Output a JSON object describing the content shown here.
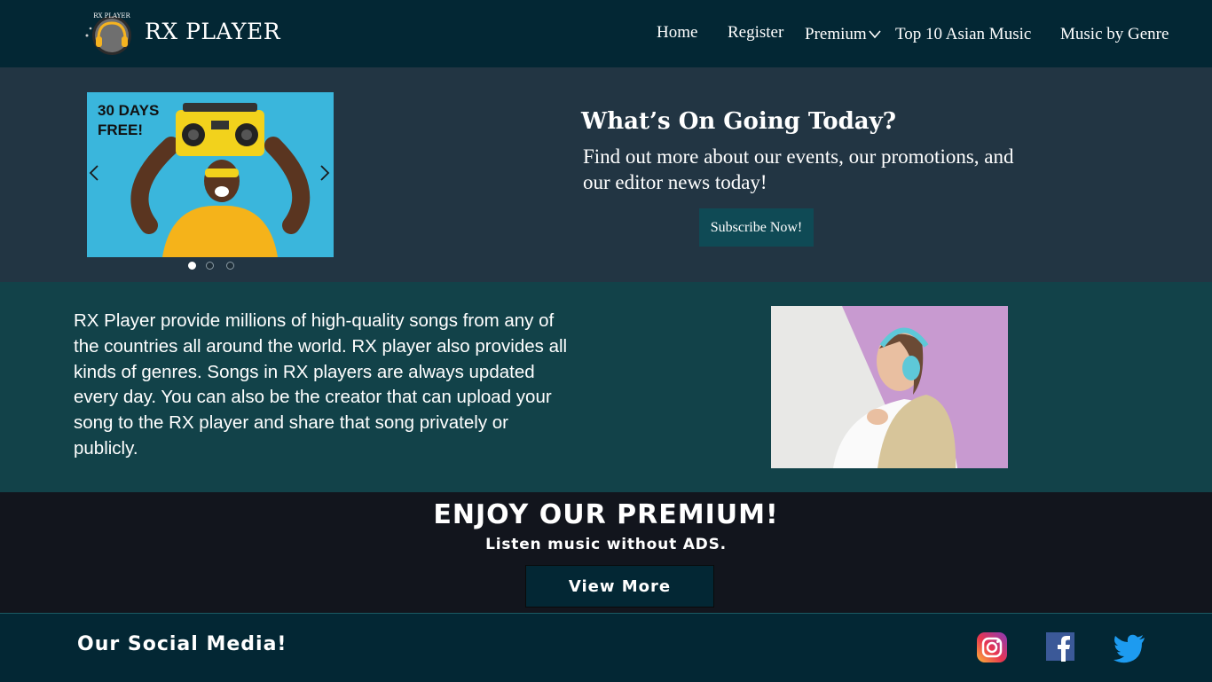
{
  "header": {
    "brand": "RX PLAYER",
    "logo_text": "RX PLAYER",
    "nav": {
      "home": "Home",
      "register": "Register",
      "premium": "Premium",
      "top10": "Top 10 Asian Music",
      "genre": "Music by Genre"
    }
  },
  "hero": {
    "slide": {
      "tag": "30 DAYS\nFREE!",
      "current": 1,
      "total": 3
    },
    "title": "What’s On Going Today?",
    "text": "Find out more about our events, our promotions, and our editor news today!",
    "subscribe_label": "Subscribe Now!"
  },
  "about": {
    "text": "RX Player provide millions of high-quality songs from any of the countries all around the world. RX player also provides all kinds of genres. Songs in RX players are always updated every day. You can also be the creator that can upload your song to the RX player and share that song privately or publicly."
  },
  "premium": {
    "title": "ENJOY OUR PREMIUM!",
    "subtitle": "Listen music without ADS.",
    "button_label": "View More"
  },
  "footer": {
    "social_title": "Our Social Media!",
    "icons": [
      "instagram-icon",
      "facebook-icon",
      "twitter-icon"
    ]
  },
  "colors": {
    "header_bg": "#032734",
    "hero_bg": "#223543",
    "about_bg": "#124249",
    "premium_bg": "#12151d",
    "button_bg": "#0f4a55"
  }
}
